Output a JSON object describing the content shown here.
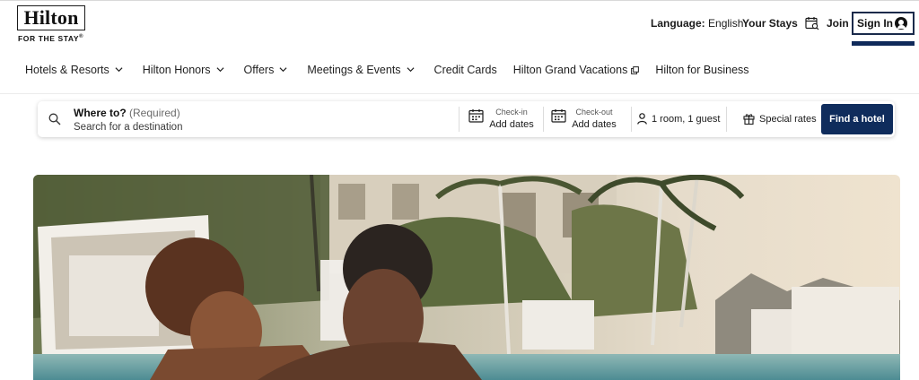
{
  "brand": {
    "name": "Hilton",
    "tagline": "FOR THE STAY",
    "tagline_mark": "®"
  },
  "utility_nav": {
    "language_label": "Language:",
    "language_value": "English",
    "your_stays": "Your Stays",
    "join": "Join",
    "sign_in": "Sign In"
  },
  "main_nav": {
    "items": [
      {
        "label": "Hotels & Resorts",
        "icon": "chevron-down-icon"
      },
      {
        "label": "Hilton Honors",
        "icon": "chevron-down-icon"
      },
      {
        "label": "Offers",
        "icon": "chevron-down-icon"
      },
      {
        "label": "Meetings & Events",
        "icon": "chevron-down-icon"
      },
      {
        "label": "Credit Cards",
        "icon": ""
      },
      {
        "label": "Hilton Grand Vacations",
        "icon": "external-link-icon"
      },
      {
        "label": "Hilton for Business",
        "icon": ""
      }
    ]
  },
  "search": {
    "where_title": "Where to?",
    "where_required": "(Required)",
    "where_placeholder": "Search for a destination",
    "checkin_label": "Check-in",
    "checkin_value": "Add dates",
    "checkout_label": "Check-out",
    "checkout_value": "Add dates",
    "rooms_guests": "1 room, 1 guest",
    "special_rates": "Special rates",
    "find_button": "Find a hotel"
  },
  "colors": {
    "primary": "#0f2c5c",
    "text": "#1f1f1f",
    "muted": "#6b6b6b"
  }
}
